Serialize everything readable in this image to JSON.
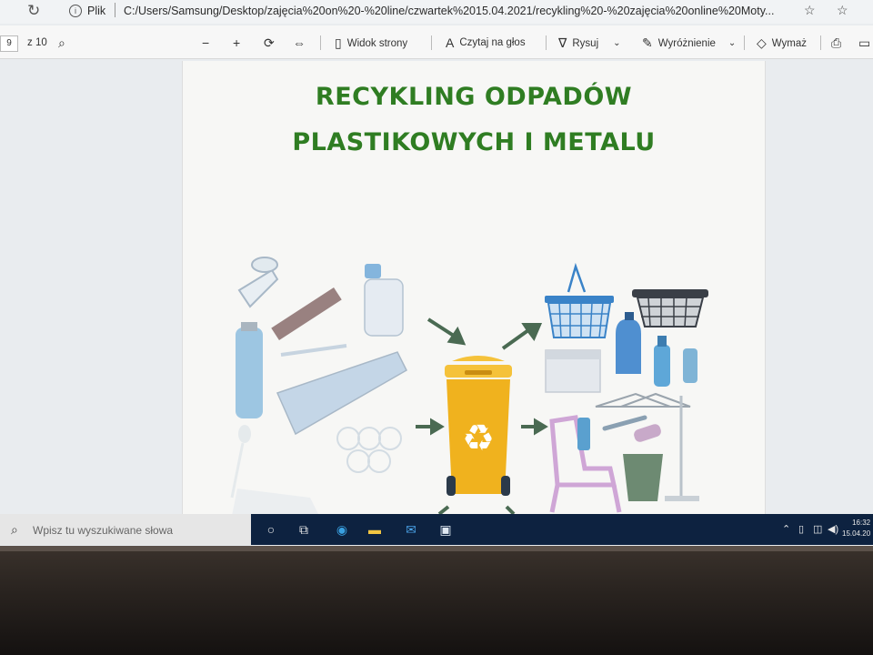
{
  "browser": {
    "site_label": "Plik",
    "url": "C:/Users/Samsung/Desktop/zajęcia%20on%20-%20line/czwartek%2015.04.2021/recykling%20-%20zajęcia%20online%20Moty..."
  },
  "toolbar": {
    "page_current": "9",
    "page_total": "z 10",
    "page_view_label": "Widok strony",
    "read_aloud_label": "Czytaj na głos",
    "draw_label": "Rysuj",
    "highlight_label": "Wyróżnienie",
    "erase_label": "Wymaż"
  },
  "document": {
    "title_line1": "RECYKLING ODPADÓW",
    "title_line2": "PLASTIKOWYCH I METALU",
    "colors": {
      "title": "#2f7d22",
      "bin": "#f0b21e",
      "arrow": "#4a6a52",
      "basket_blue": "#3a83c8"
    }
  },
  "taskbar": {
    "search_placeholder": "Wpisz tu wyszukiwane słowa",
    "clock_time": "16:32",
    "clock_date": "15.04.20"
  }
}
